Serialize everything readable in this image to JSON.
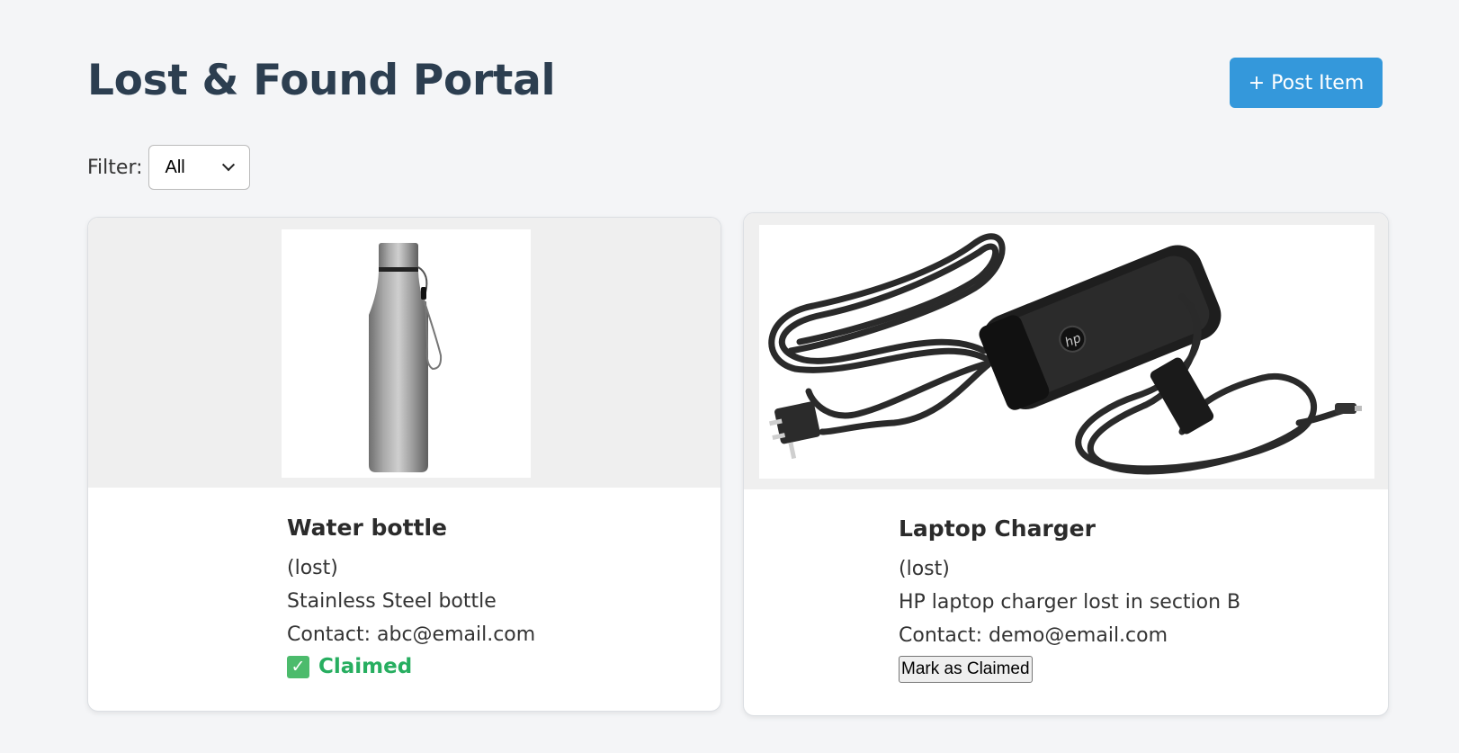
{
  "header": {
    "title": "Lost & Found Portal",
    "post_button_label": "+ Post Item"
  },
  "filter": {
    "label": "Filter:",
    "selected": "All"
  },
  "items": [
    {
      "title": "Water bottle",
      "status": "(lost)",
      "description": "Stainless Steel bottle",
      "contact": "Contact: abc@email.com",
      "claimed_label": "Claimed",
      "image_icon": "water-bottle-photo"
    },
    {
      "title": "Laptop Charger",
      "status": "(lost)",
      "description": "HP laptop charger lost in section B",
      "contact": "Contact: demo@email.com",
      "claim_button_label": "Mark as Claimed",
      "image_icon": "laptop-charger-photo",
      "logo_text": "hp"
    }
  ],
  "colors": {
    "primary": "#3498db",
    "title": "#2c3e50",
    "claimed": "#27ae60",
    "background": "#f4f5f7"
  }
}
